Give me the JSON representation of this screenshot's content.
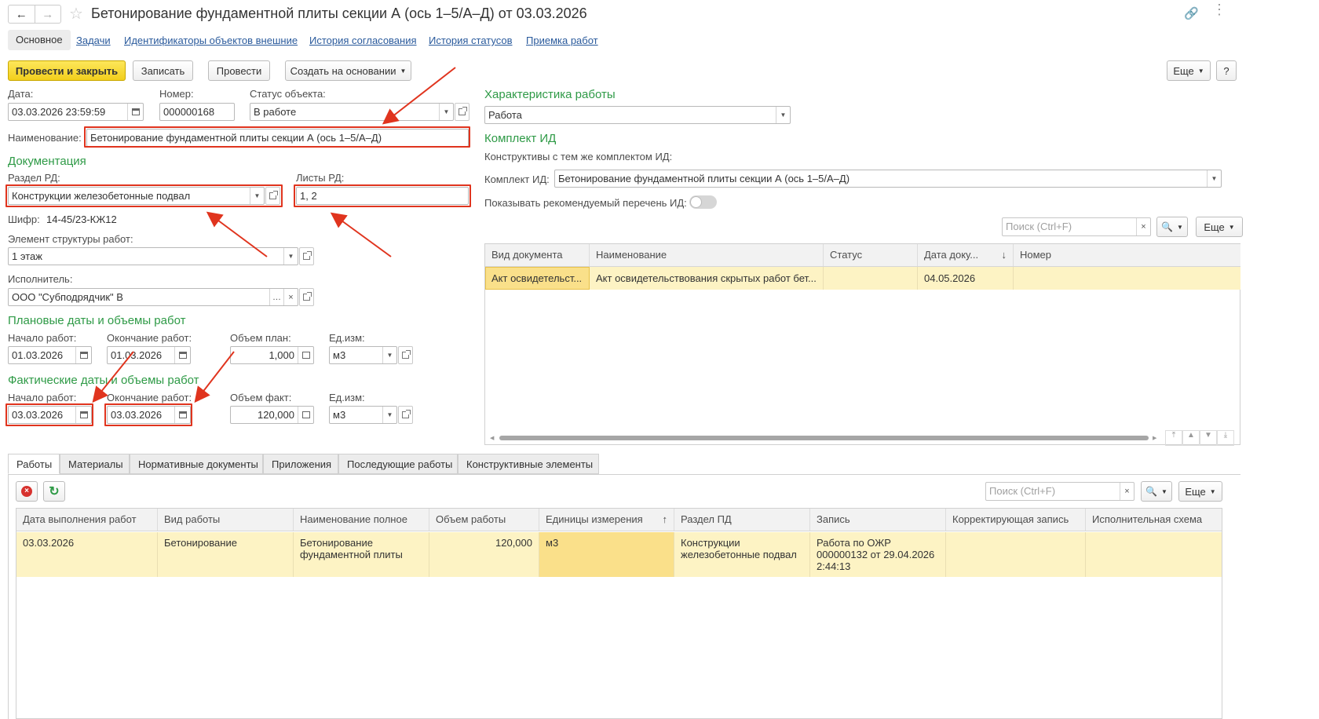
{
  "header": {
    "title": "Бетонирование фундаментной плиты секции А (ось 1–5/А–Д) от 03.03.2026"
  },
  "tabs_top": [
    "Основное",
    "Задачи",
    "Идентификаторы объектов внешние",
    "История согласования",
    "История статусов",
    "Приемка работ"
  ],
  "toolbar": {
    "post_close": "Провести и закрыть",
    "save": "Записать",
    "post": "Провести",
    "create_based": "Создать на основании",
    "more": "Еще",
    "help": "?"
  },
  "form": {
    "date_label": "Дата:",
    "date_value": "03.03.2026 23:59:59",
    "number_label": "Номер:",
    "number_value": "000000168",
    "status_label": "Статус объекта:",
    "status_value": "В работе",
    "name_label": "Наименование:",
    "name_value": "Бетонирование фундаментной плиты секции А (ось 1–5/А–Д)",
    "doc_section": "Документация",
    "rd_section_label": "Раздел РД:",
    "rd_section_value": "Конструкции железобетонные подвал",
    "rd_sheets_label": "Листы РД:",
    "rd_sheets_value": "1, 2",
    "cipher_label": "Шифр:",
    "cipher_value": "14-45/23-КЖ12",
    "structure_label": "Элемент структуры работ:",
    "structure_value": "1 этаж",
    "executor_label": "Исполнитель:",
    "executor_value": "ООО \"Субподрядчик\" В",
    "plan_section": "Плановые даты и объемы работ",
    "plan_start_label": "Начало работ:",
    "plan_start_value": "01.03.2026",
    "plan_end_label": "Окончание работ:",
    "plan_end_value": "01.03.2026",
    "plan_volume_label": "Объем план:",
    "plan_volume_value": "1,000",
    "plan_unit_label": "Ед.изм:",
    "plan_unit_value": "м3",
    "fact_section": "Фактические даты и объемы работ",
    "fact_start_label": "Начало работ:",
    "fact_start_value": "03.03.2026",
    "fact_end_label": "Окончание работ:",
    "fact_end_value": "03.03.2026",
    "fact_volume_label": "Объем факт:",
    "fact_volume_value": "120,000",
    "fact_unit_label": "Ед.изм:",
    "fact_unit_value": "м3"
  },
  "right": {
    "char_section": "Характеристика работы",
    "char_value": "Работа",
    "kit_section": "Комплект ИД",
    "kit_note": "Конструктивы с тем же комплектом ИД:",
    "kit_label": "Комплект ИД:",
    "kit_value": "Бетонирование фундаментной плиты секции А (ось 1–5/А–Д)",
    "show_label": "Показывать рекомендуемый перечень ИД:",
    "search_placeholder": "Поиск (Ctrl+F)",
    "more": "Еще",
    "columns": [
      "Вид документа",
      "Наименование",
      "Статус",
      "Дата доку...",
      "Номер"
    ],
    "row": [
      "Акт освидетельст...",
      "Акт освидетельствования скрытых работ бет...",
      "",
      "04.05.2026",
      ""
    ]
  },
  "bottom": {
    "tabs": [
      "Работы",
      "Материалы",
      "Нормативные документы",
      "Приложения",
      "Последующие работы",
      "Конструктивные элементы"
    ],
    "search_placeholder": "Поиск (Ctrl+F)",
    "more": "Еще",
    "columns": [
      "Дата выполнения работ",
      "Вид работы",
      "Наименование полное",
      "Объем работы",
      "Единицы измерения",
      "Раздел ПД",
      "Запись",
      "Корректирующая запись",
      "Исполнительная схема"
    ],
    "row": {
      "date": "03.03.2026",
      "kind": "Бетонирование",
      "name_line1": "Бетонирование",
      "name_line2": "фундаментной плиты",
      "volume": "120,000",
      "unit": "м3",
      "section_line1": "Конструкции",
      "section_line2": "железобетонные подвал",
      "record_line1": "Работа по ОЖР",
      "record_line2": "000000132 от 29.04.2026",
      "record_line3": "2:44:13",
      "corr": "",
      "scheme": ""
    }
  },
  "colors": {
    "accent_green": "#2e9a46",
    "highlight_red": "#e0341e",
    "primary_yellow": "#f5d52a",
    "row_highlight": "#fdf3c4"
  }
}
